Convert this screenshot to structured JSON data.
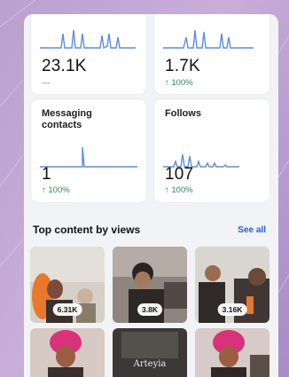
{
  "metrics": [
    {
      "title": "",
      "value": "23.1K",
      "change": "—",
      "change_type": "neutral"
    },
    {
      "title": "",
      "value": "1.7K",
      "change": "↑ 100%",
      "change_type": "up"
    },
    {
      "title": "Messaging contacts",
      "title_lines": [
        "Messaging",
        "contacts"
      ],
      "value": "1",
      "change": "↑ 100%",
      "change_type": "up"
    },
    {
      "title": "Follows",
      "title_lines": [
        "Follows",
        ""
      ],
      "value": "107",
      "change": "↑ 100%",
      "change_type": "up"
    }
  ],
  "top_content": {
    "title": "Top content by views",
    "see_all_label": "See all",
    "items": [
      {
        "views": "6.31K",
        "caption": ""
      },
      {
        "views": "3.8K",
        "caption": ""
      },
      {
        "views": "3.16K",
        "caption": ""
      },
      {
        "views": "",
        "caption": ""
      },
      {
        "views": "",
        "caption": "Arteyia"
      },
      {
        "views": "",
        "caption": ""
      }
    ]
  },
  "colors": {
    "sparkline": "#5b8fd9",
    "positive_change": "#2e8b57",
    "link": "#2a5bd7"
  }
}
